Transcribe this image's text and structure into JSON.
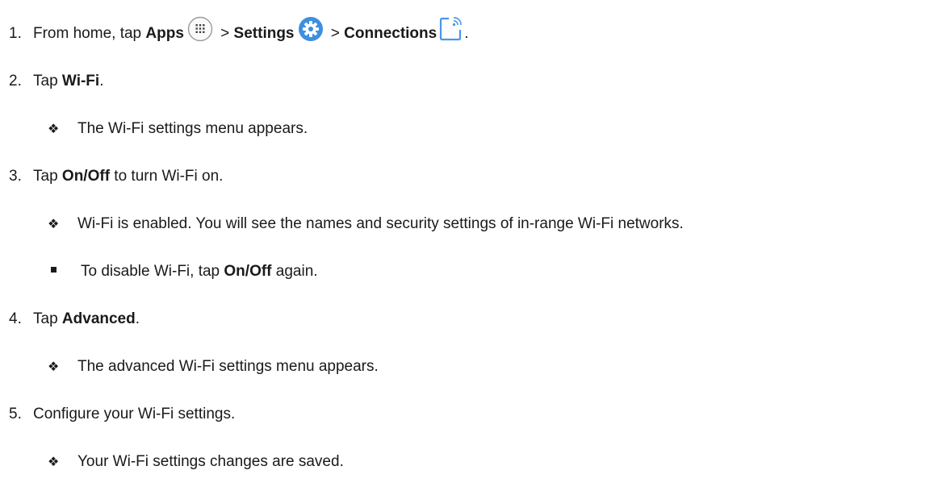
{
  "steps": [
    {
      "num": "1.",
      "pre": "From home, tap ",
      "apps": "Apps",
      "sep1": " > ",
      "settings": "Settings",
      "sep2": " > ",
      "connections": "Connections",
      "post": "."
    },
    {
      "num": "2.",
      "pre": "Tap ",
      "bold": "Wi-Fi",
      "post": "."
    },
    {
      "num": "3.",
      "pre": "Tap ",
      "bold": "On/Off",
      "post": " to turn Wi-Fi on."
    },
    {
      "num": "4.",
      "pre": "Tap ",
      "bold": "Advanced",
      "post": "."
    },
    {
      "num": "5.",
      "text": "Configure your Wi-Fi settings."
    }
  ],
  "results": {
    "r2": "The Wi-Fi settings menu appears.",
    "r3": "Wi-Fi is enabled. You will see the names and security settings of in-range Wi-Fi networks.",
    "r4": "The advanced Wi-Fi settings menu appears.",
    "r5": "Your Wi-Fi settings changes are saved."
  },
  "note3": {
    "pre": "To disable Wi-Fi, tap ",
    "bold": "On/Off",
    "post": " again."
  },
  "bullet_glyph": "❖",
  "icons": {
    "apps": "apps-grid-icon",
    "settings": "settings-gear-icon",
    "connections": "connections-icon"
  },
  "colors": {
    "text": "#1a1a1a",
    "settings_blue": "#3d8fe0"
  }
}
